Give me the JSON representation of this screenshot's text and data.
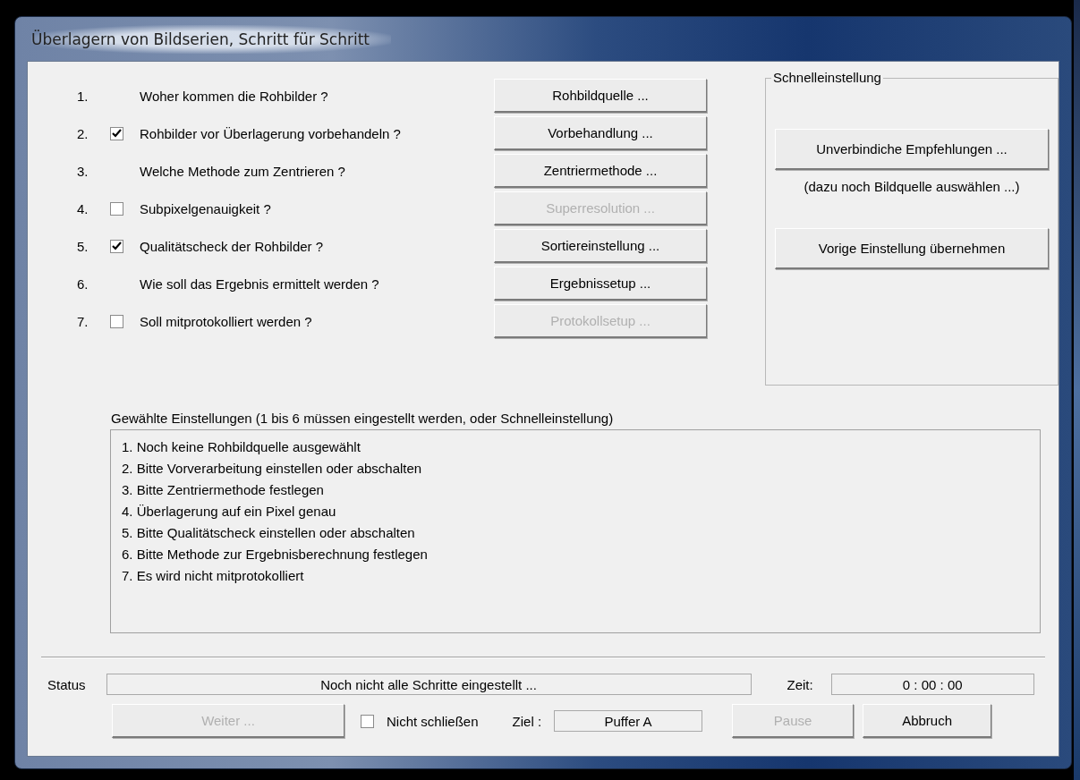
{
  "window": {
    "title": "Überlagern von Bildserien, Schritt für Schritt"
  },
  "steps": [
    {
      "number": "1.",
      "kind": "plain",
      "label": "Woher kommen die Rohbilder ?",
      "button": {
        "label": "Rohbildquelle ...",
        "disabled": false
      }
    },
    {
      "number": "2.",
      "kind": "checkbox",
      "checked": true,
      "label": "Rohbilder vor Überlagerung vorbehandeln ?",
      "button": {
        "label": "Vorbehandlung ...",
        "disabled": false
      }
    },
    {
      "number": "3.",
      "kind": "plain",
      "label": "Welche Methode zum Zentrieren ?",
      "button": {
        "label": "Zentriermethode ...",
        "disabled": false
      }
    },
    {
      "number": "4.",
      "kind": "checkbox",
      "checked": false,
      "label": "Subpixelgenauigkeit ?",
      "button": {
        "label": "Superresolution ...",
        "disabled": true
      }
    },
    {
      "number": "5.",
      "kind": "checkbox",
      "checked": true,
      "label": "Qualitätscheck der Rohbilder ?",
      "button": {
        "label": "Sortiereinstellung ...",
        "disabled": false
      }
    },
    {
      "number": "6.",
      "kind": "plain",
      "label": "Wie soll das Ergebnis ermittelt werden ?",
      "button": {
        "label": "Ergebnissetup ...",
        "disabled": false
      }
    },
    {
      "number": "7.",
      "kind": "checkbox",
      "checked": false,
      "label": "Soll mitprotokolliert werden ?",
      "button": {
        "label": "Protokollsetup ...",
        "disabled": true
      }
    }
  ],
  "quick_settings": {
    "title": "Schnelleinstellung",
    "items": [
      {
        "kind": "button",
        "text": "Unverbindiche Empfehlungen ..."
      },
      {
        "kind": "note",
        "text": "(dazu noch Bildquelle auswählen ...)"
      },
      {
        "kind": "button",
        "text": "Vorige Einstellung übernehmen"
      }
    ]
  },
  "summary": {
    "label": "Gewählte Einstellungen (1 bis 6 müssen eingestellt werden, oder Schnelleinstellung)",
    "lines": [
      "1. Noch keine Rohbildquelle ausgewählt",
      "2. Bitte Vorverarbeitung einstellen oder abschalten",
      "3. Bitte Zentriermethode festlegen",
      "4. Überlagerung auf ein Pixel genau",
      "5. Bitte Qualitätscheck einstellen oder abschalten",
      "6. Bitte Methode zur Ergebnisberechnung festlegen",
      "7. Es wird nicht mitprotokolliert"
    ]
  },
  "status": {
    "label": "Status",
    "value": "Noch nicht alle Schritte eingestellt ...",
    "time_label": "Zeit:",
    "time": "0 : 00 : 00"
  },
  "footer": {
    "next_button": {
      "label": "Weiter ...",
      "disabled": true
    },
    "keep_open": {
      "label": "Nicht schließen",
      "checked": false
    },
    "target_label": "Ziel :",
    "target": "Puffer A",
    "pause_button": {
      "label": "Pause",
      "disabled": true
    },
    "cancel_button": {
      "label": "Abbruch",
      "disabled": false
    }
  }
}
